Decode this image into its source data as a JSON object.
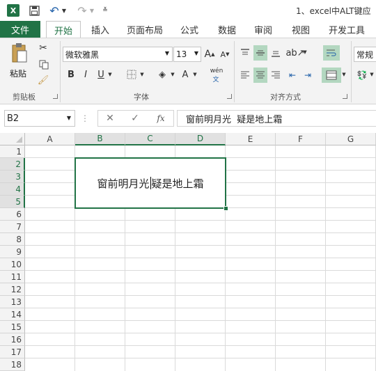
{
  "titlebar": {
    "app_icon": "excel-icon",
    "title": "1、excel中ALT键应"
  },
  "tabs": {
    "file": "文件",
    "items": [
      "开始",
      "插入",
      "页面布局",
      "公式",
      "数据",
      "审阅",
      "视图",
      "开发工具"
    ]
  },
  "ribbon": {
    "clipboard": {
      "paste": "粘贴",
      "label": "剪贴板"
    },
    "font": {
      "name": "微软雅黑",
      "size": "13",
      "bold": "B",
      "italic": "I",
      "underline": "U",
      "font_color": "A",
      "wen": "wén",
      "label": "字体"
    },
    "alignment": {
      "label": "对齐方式"
    },
    "number": {
      "format": "常规"
    }
  },
  "formula_bar": {
    "name_box": "B2",
    "fx": "fx",
    "content": "窗前明月光  疑是地上霜"
  },
  "grid": {
    "columns": [
      "A",
      "B",
      "C",
      "D",
      "E",
      "F",
      "G"
    ],
    "rows": [
      "1",
      "2",
      "3",
      "4",
      "5",
      "6",
      "7",
      "8",
      "9",
      "10",
      "11",
      "12",
      "13",
      "14",
      "15",
      "16",
      "17",
      "18"
    ],
    "merged_cell_text_before": "窗前明月光",
    "merged_cell_text_after": "疑是地上霜"
  },
  "colors": {
    "accent": "#217346",
    "highlight": "#b3d7c0"
  }
}
